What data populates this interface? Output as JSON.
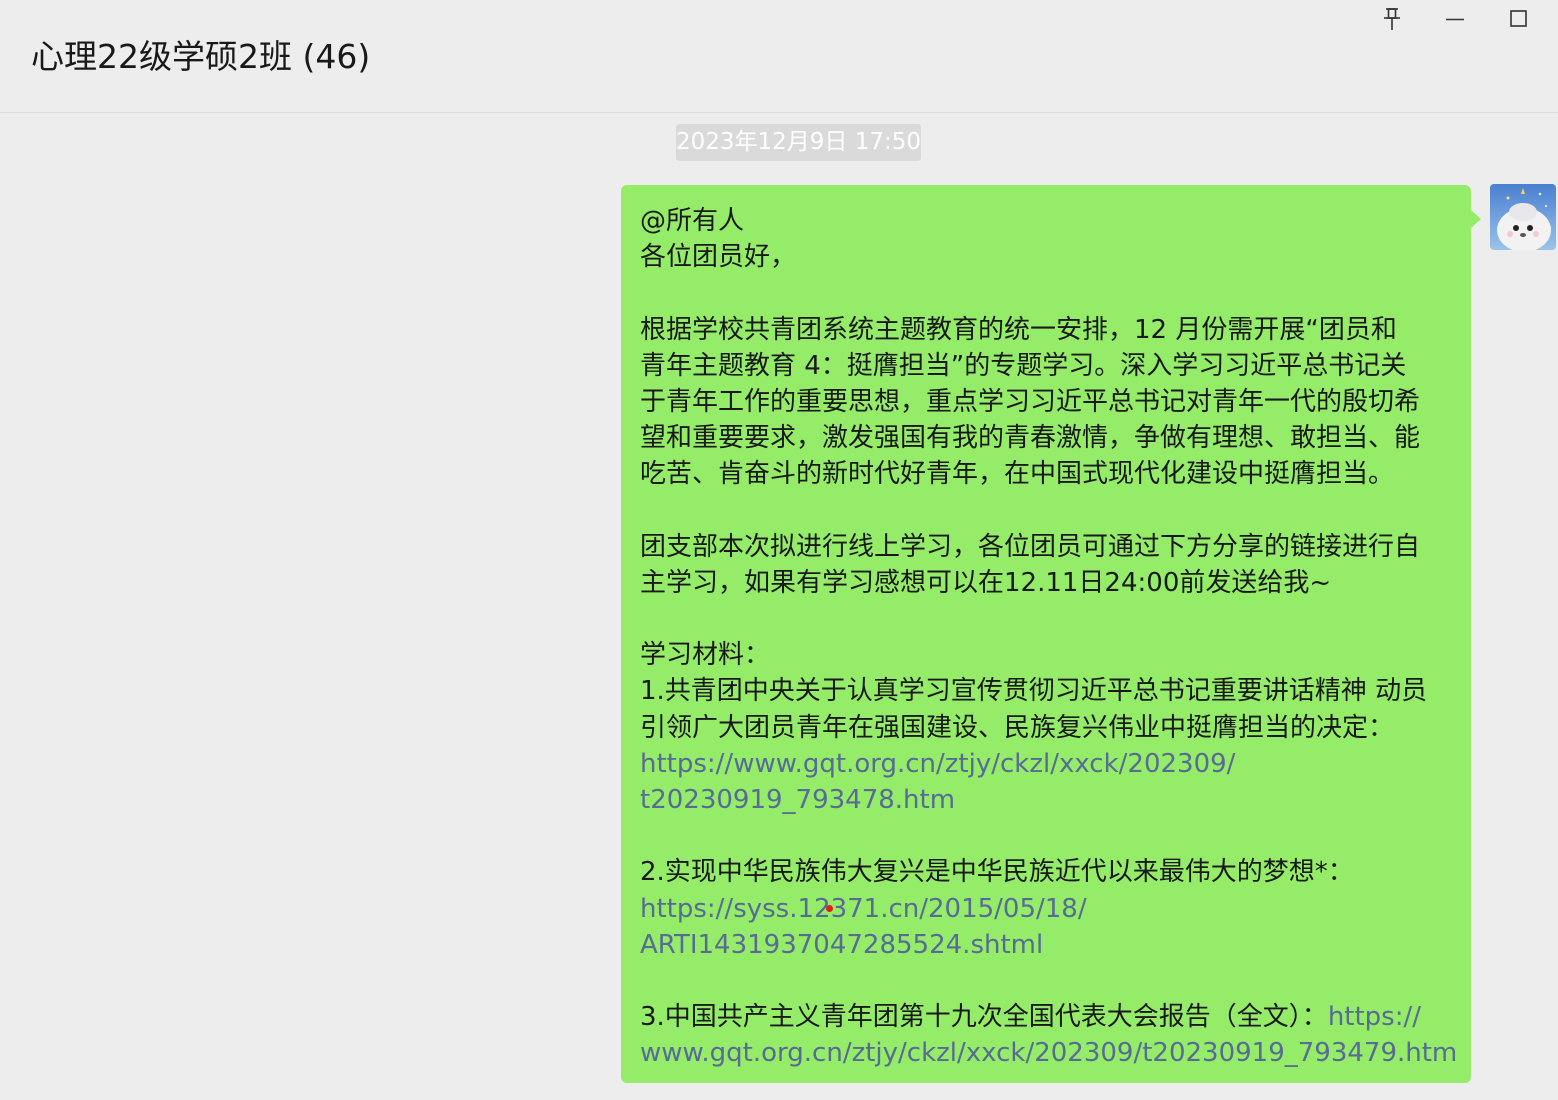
{
  "header": {
    "title": "心理22级学硕2班 (46)"
  },
  "window_controls": {
    "pin_icon": "pin-icon",
    "minimize_icon": "minimize-icon",
    "maximize_icon": "maximize-icon"
  },
  "chat": {
    "timestamp": "2023年12月9日 17:50",
    "message": {
      "lines": [
        "@所有人",
        "各位团员好，",
        "根据学校共青团系统主题教育的统一安排，12 月份需开展“团员和",
        "青年主题教育 4：挺膺担当”的专题学习。深入学习习近平总书记关",
        "于青年工作的重要思想，重点学习习近平总书记对青年一代的殷切希",
        "望和重要要求，激发强国有我的青春激情，争做有理想、敢担当、能",
        "吃苦、肯奋斗的新时代好青年，在中国式现代化建设中挺膺担当。",
        "团支部本次拟进行线上学习，各位团员可通过下方分享的链接进行自",
        "主学习，如果有学习感想可以在12.11日24:00前发送给我~",
        "学习材料：",
        "1.共青团中央关于认真学习宣传贯彻习近平总书记重要讲话精神 动员",
        "引领广大团员青年在强国建设、民族复兴伟业中挺膺担当的决定：",
        "2.实现中华民族伟大复兴是中华民族近代以来最伟大的梦想*：",
        "3.中国共产主义青年团第十九次全国代表大会报告（全文）："
      ],
      "links": [
        "https://www.gqt.org.cn/ztjy/ckzl/xxck/202309/",
        "t20230919_793478.htm",
        "https://syss.12371.cn/2015/05/18/",
        "ARTI1431937047285524.shtml",
        "https://",
        "www.gqt.org.cn/ztjy/ckzl/xxck/202309/t20230919_793479.htm"
      ]
    }
  },
  "colors": {
    "bubble": "#95ec69",
    "link": "#576b95",
    "background": "#ededed"
  }
}
